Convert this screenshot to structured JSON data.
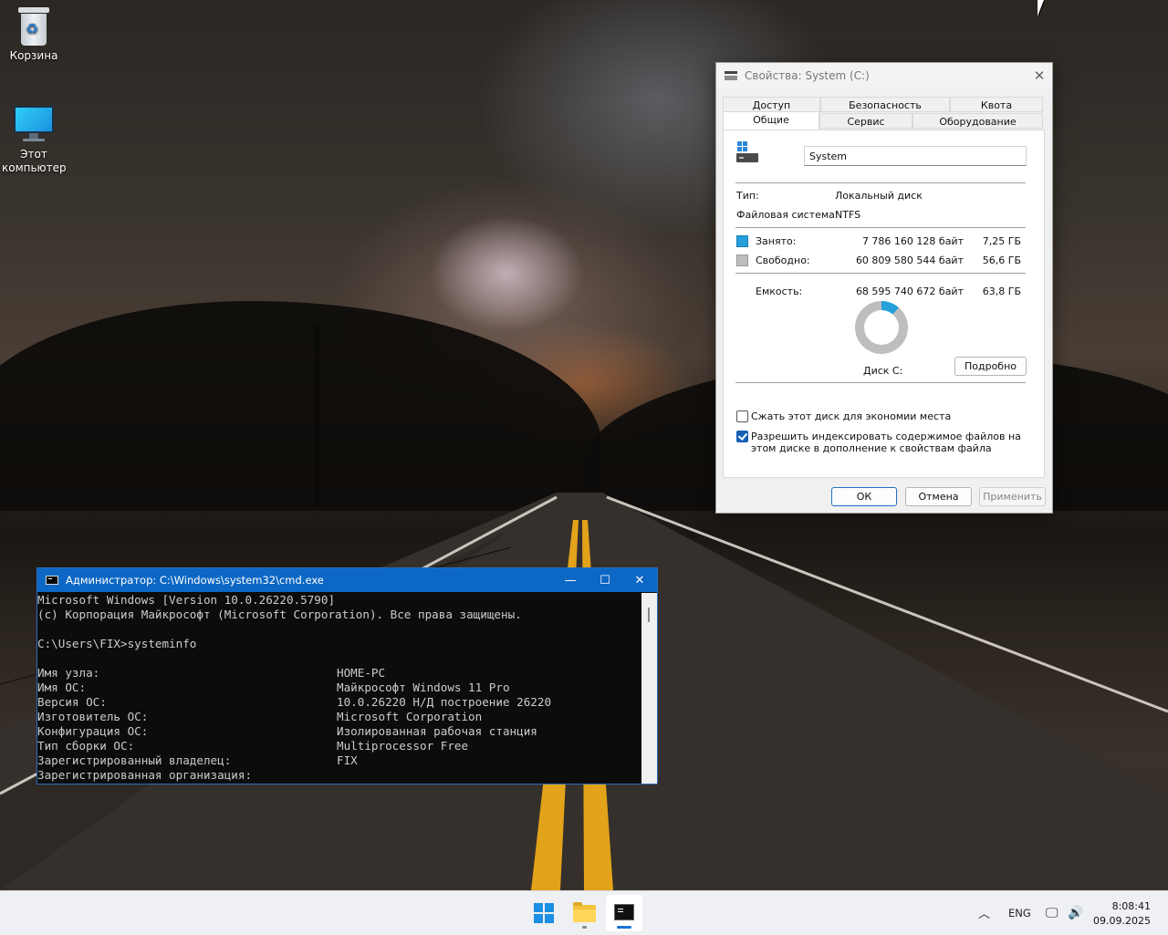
{
  "desktop": {
    "icons": [
      {
        "label": "Корзина"
      },
      {
        "label": "Этот компьютер"
      }
    ]
  },
  "properties": {
    "title": "Свойства: System (C:)",
    "tabs_row1": [
      "Доступ",
      "Безопасность",
      "Квота"
    ],
    "tabs_row2": [
      "Общие",
      "Сервис",
      "Оборудование"
    ],
    "active_tab": "Общие",
    "name_value": "System",
    "type_label": "Тип:",
    "type_value": "Локальный диск",
    "fs_label": "Файловая система:",
    "fs_value": "NTFS",
    "used_label": "Занято:",
    "used_bytes": "7 786 160 128 байт",
    "used_gb": "7,25 ГБ",
    "free_label": "Свободно:",
    "free_bytes": "60 809 580 544 байт",
    "free_gb": "56,6 ГБ",
    "capacity_label": "Емкость:",
    "capacity_bytes": "68 595 740 672 байт",
    "capacity_gb": "63,8 ГБ",
    "used_fraction": 0.113,
    "disk_label": "Диск C:",
    "details_button": "Подробно",
    "compress_label": "Сжать этот диск для экономии места",
    "compress_checked": false,
    "index_label_line1": "Разрешить индексировать содержимое файлов на",
    "index_label_line2": "этом диске в дополнение к свойствам файла",
    "index_checked": true,
    "ok": "ОК",
    "cancel": "Отмена",
    "apply": "Применить",
    "colors": {
      "used": "#26a0da",
      "free": "#bebebe"
    }
  },
  "cmd": {
    "title": "Администратор: C:\\Windows\\system32\\cmd.exe",
    "lines": [
      {
        "k": "Microsoft Windows [Version 10.0.26220.5790]",
        "v": ""
      },
      {
        "k": "(c) Корпорация Майкрософт (Microsoft Corporation). Все права защищены.",
        "v": ""
      },
      {
        "k": "",
        "v": ""
      },
      {
        "k": "C:\\Users\\FIX>systeminfo",
        "v": ""
      },
      {
        "k": "",
        "v": ""
      },
      {
        "k": "Имя узла:",
        "v": "HOME-PC"
      },
      {
        "k": "Имя ОС:",
        "v": "Майкрософт Windows 11 Pro"
      },
      {
        "k": "Версия ОС:",
        "v": "10.0.26220 Н/Д построение 26220"
      },
      {
        "k": "Изготовитель ОС:",
        "v": "Microsoft Corporation"
      },
      {
        "k": "Конфигурация ОС:",
        "v": "Изолированная рабочая станция"
      },
      {
        "k": "Тип сборки ОС:",
        "v": "Multiprocessor Free"
      },
      {
        "k": "Зарегистрированный владелец:",
        "v": "FIX"
      },
      {
        "k": "Зарегистрированная организация:",
        "v": ""
      }
    ]
  },
  "taskbar": {
    "lang": "ENG",
    "time": "8:08:41",
    "date": "09.09.2025"
  }
}
